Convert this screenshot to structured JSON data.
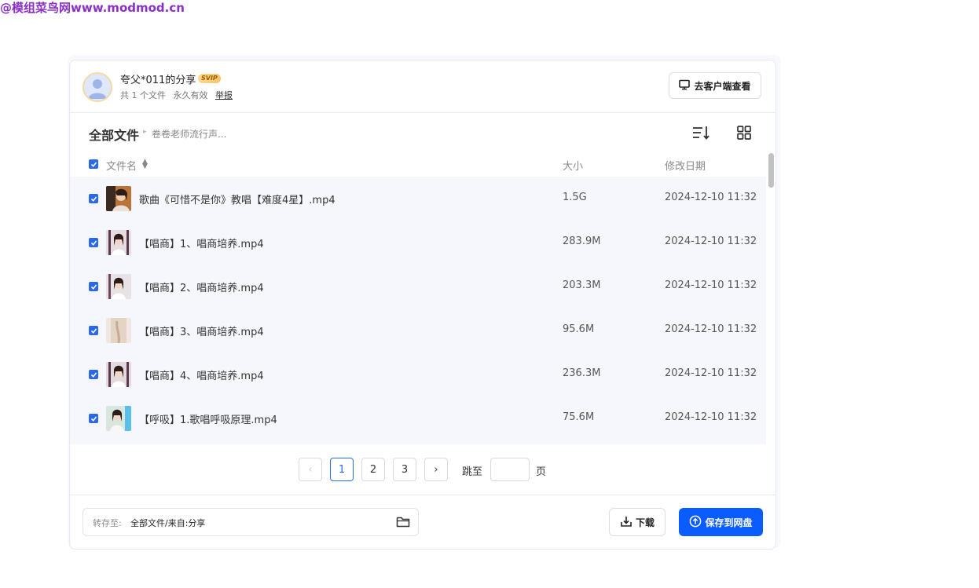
{
  "watermark": "@模组菜鸟网www.modmod.cn",
  "share": {
    "title": "夸父*011的分享",
    "badge": "SVIP",
    "file_count": "共 1 个文件",
    "validity": "永久有效",
    "report": "举报",
    "client_button": "去客户端查看"
  },
  "breadcrumb": {
    "root": "全部文件",
    "current": "卷卷老师流行声..."
  },
  "table": {
    "headers": {
      "name": "文件名",
      "size": "大小",
      "date": "修改日期"
    },
    "rows": [
      {
        "name": "歌曲《可惜不是你》教唱【难度4星】.mp4",
        "size": "1.5G",
        "date": "2024-12-10 11:32",
        "checked": true
      },
      {
        "name": "【唱商】1、唱商培养.mp4",
        "size": "283.9M",
        "date": "2024-12-10 11:32",
        "checked": true
      },
      {
        "name": "【唱商】2、唱商培养.mp4",
        "size": "203.3M",
        "date": "2024-12-10 11:32",
        "checked": true
      },
      {
        "name": "【唱商】3、唱商培养.mp4",
        "size": "95.6M",
        "date": "2024-12-10 11:32",
        "checked": true
      },
      {
        "name": "【唱商】4、唱商培养.mp4",
        "size": "236.3M",
        "date": "2024-12-10 11:32",
        "checked": true
      },
      {
        "name": "【呼吸】1.歌唱呼吸原理.mp4",
        "size": "75.6M",
        "date": "2024-12-10 11:32",
        "checked": true
      }
    ]
  },
  "pagination": {
    "pages": [
      "1",
      "2",
      "3"
    ],
    "current": "1",
    "jump_label": "跳至",
    "jump_unit": "页",
    "prev": "‹",
    "next": "›"
  },
  "footer": {
    "path_label": "转存至:",
    "path_value": "全部文件/来自:分享",
    "download_button": "下载",
    "save_button": "保存到网盘"
  },
  "colors": {
    "accent": "#0b5cff",
    "checkbox": "#2a6ae9",
    "row_bg": "#f5f7fd"
  }
}
